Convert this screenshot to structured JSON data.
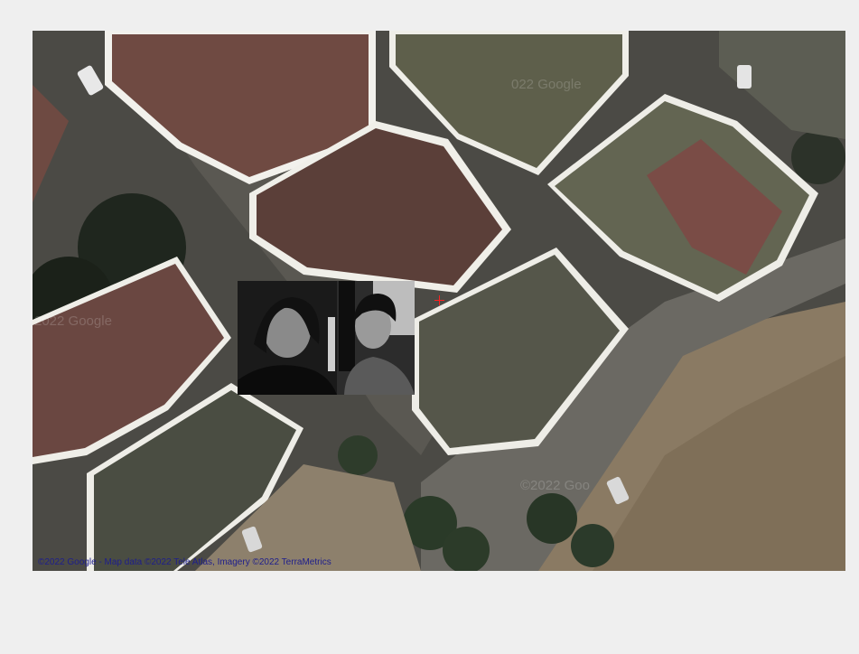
{
  "map": {
    "type": "satellite",
    "attribution": "©2022 Google - Map data ©2022 Tele Atlas, Imagery ©2022 TerraMetrics",
    "watermarks": [
      "022 Google",
      "2022 Google",
      "©2022 Goo"
    ],
    "marker_icon": "crosshair-icon",
    "marker_color": "#ff2020"
  },
  "overlay": {
    "kind": "photo",
    "style": "grayscale"
  },
  "colors": {
    "background": "#efefef",
    "attribution": "#1e1e8c"
  }
}
